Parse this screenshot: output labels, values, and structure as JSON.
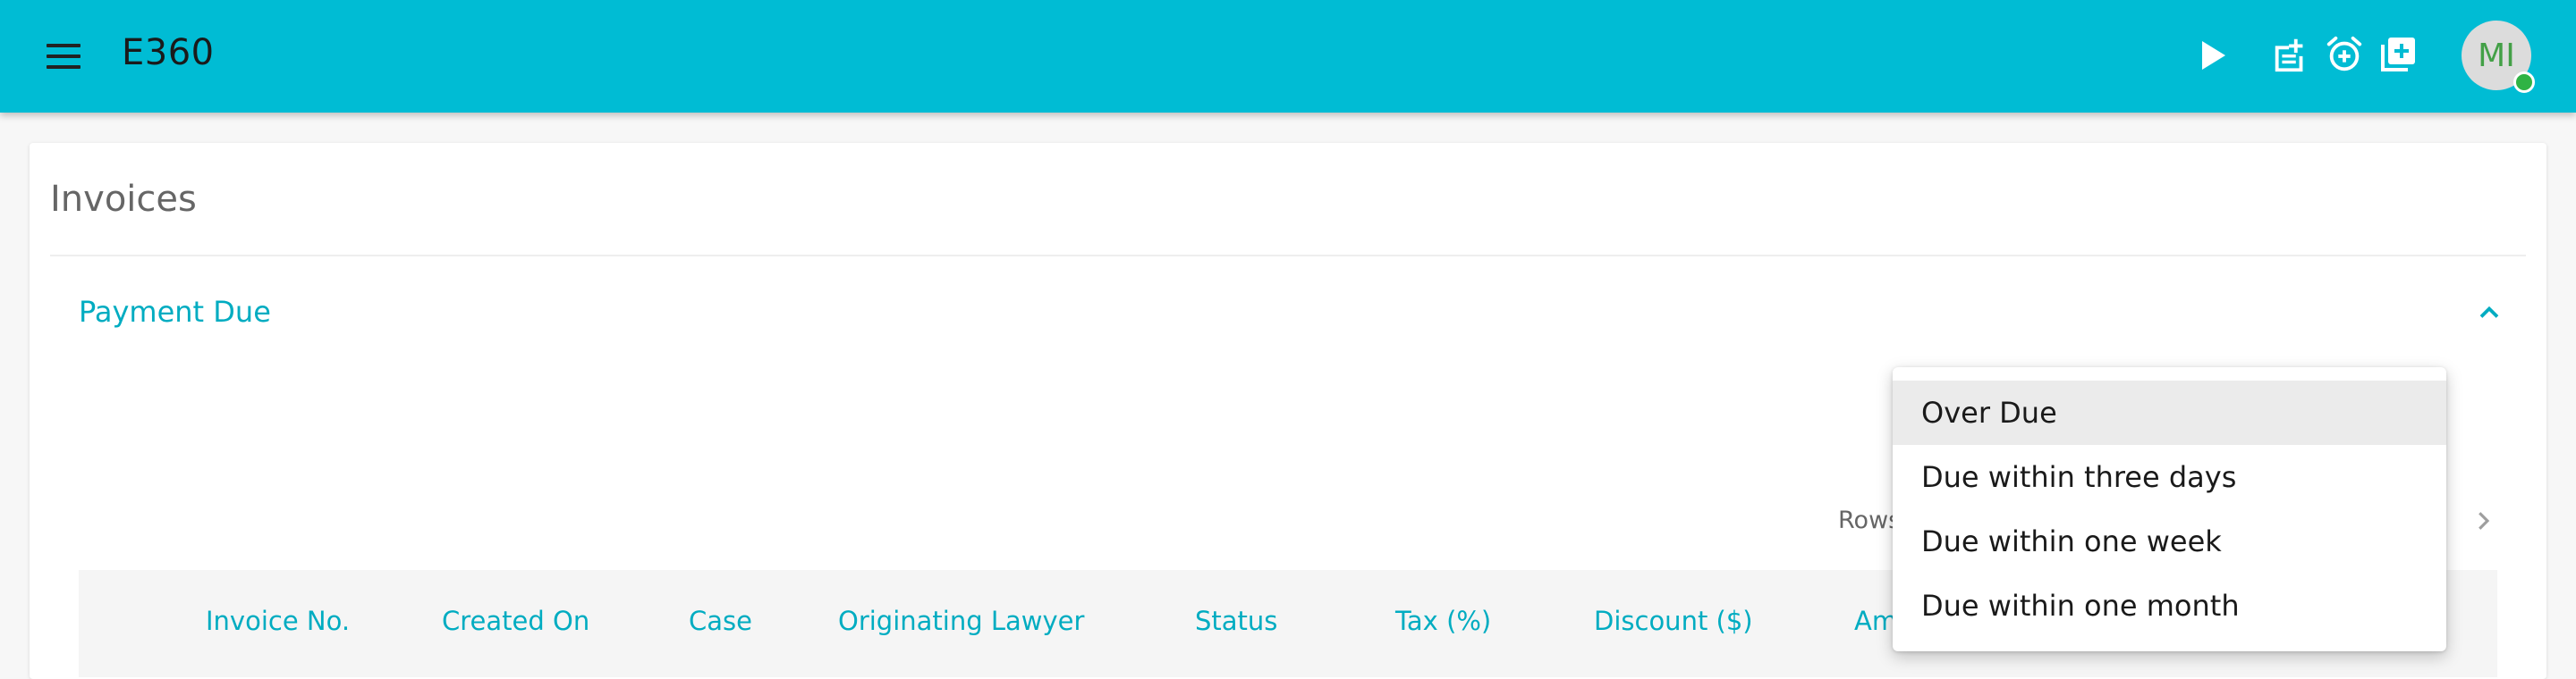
{
  "app": {
    "title": "E360"
  },
  "header": {
    "avatar_initials": "MI"
  },
  "page": {
    "title": "Invoices"
  },
  "section": {
    "title": "Payment Due"
  },
  "pagination": {
    "rows_label": "Rows"
  },
  "table": {
    "columns": [
      "Invoice No.",
      "Created On",
      "Case",
      "Originating Lawyer",
      "Status",
      "Tax (%)",
      "Discount ($)",
      "Amou"
    ]
  },
  "dropdown": {
    "options": [
      "Over Due",
      "Due within three days",
      "Due within one week",
      "Due within one month"
    ],
    "selected": "Over Due"
  },
  "colors": {
    "appbar": "#00bcd4",
    "accent": "#00acc1",
    "avatar_text": "#43a047",
    "online": "#2fb344"
  },
  "icons": [
    "menu-icon",
    "play-icon",
    "note-add-icon",
    "alarm-add-icon",
    "library-add-icon",
    "chevron-up-icon",
    "chevron-right-icon"
  ]
}
